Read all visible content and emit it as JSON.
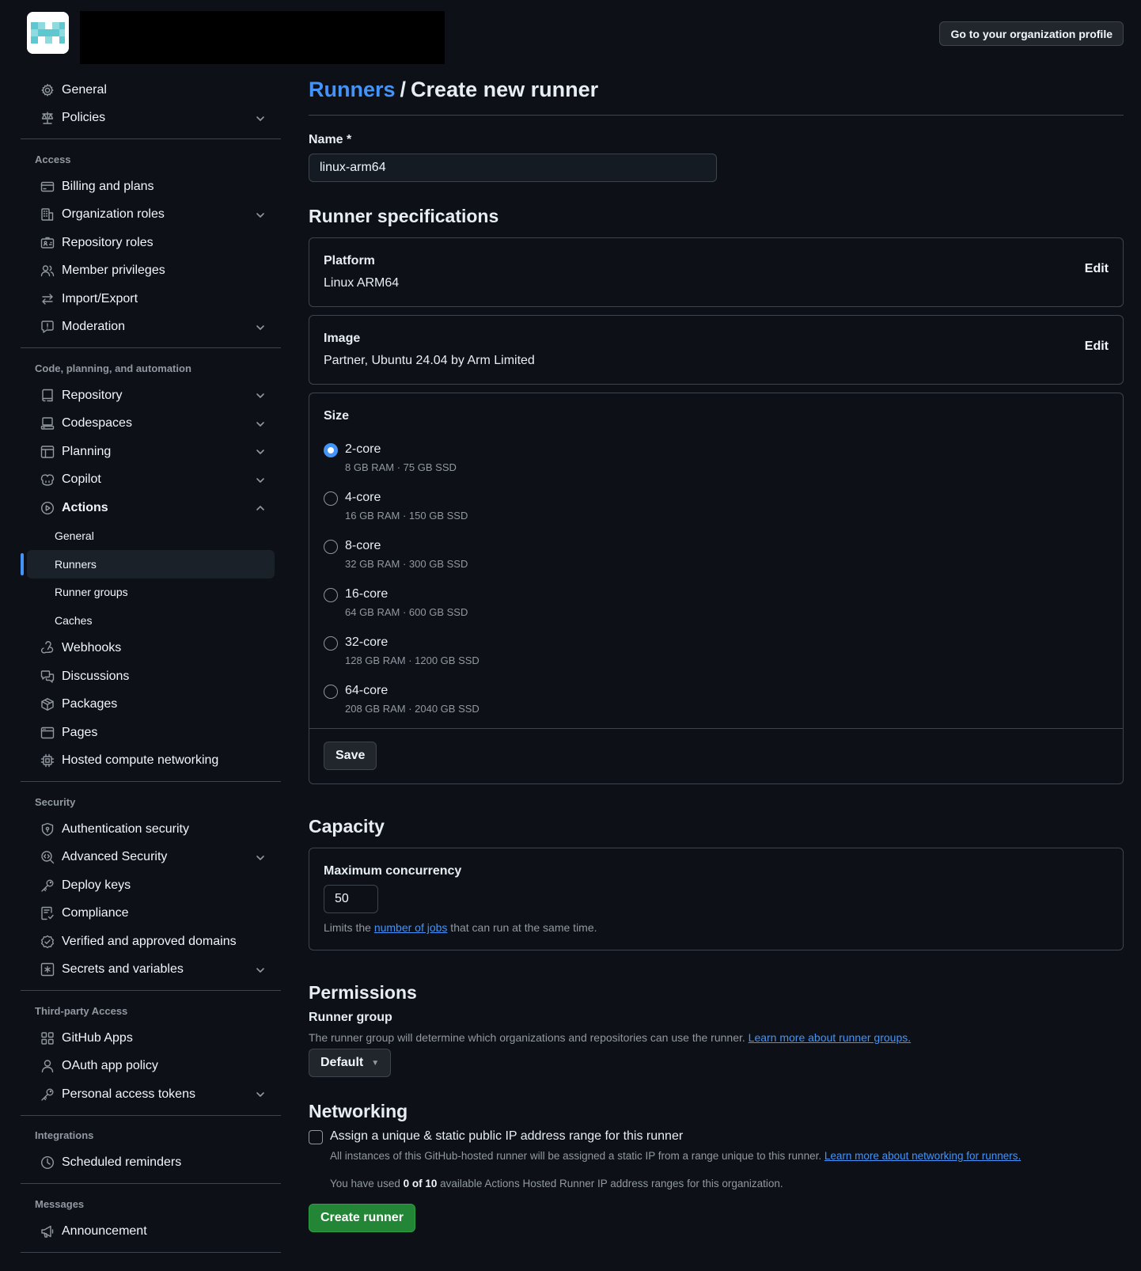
{
  "header": {
    "profile_button": "Go to your organization profile"
  },
  "sidebar": {
    "top": [
      {
        "label": "General",
        "icon": "gear-icon",
        "chevron": false
      },
      {
        "label": "Policies",
        "icon": "law-icon",
        "chevron": true
      }
    ],
    "sections": [
      {
        "heading": "Access",
        "items": [
          {
            "label": "Billing and plans",
            "icon": "credit-card-icon",
            "chevron": false
          },
          {
            "label": "Organization roles",
            "icon": "organization-icon",
            "chevron": true
          },
          {
            "label": "Repository roles",
            "icon": "id-badge-icon",
            "chevron": false
          },
          {
            "label": "Member privileges",
            "icon": "people-icon",
            "chevron": false
          },
          {
            "label": "Import/Export",
            "icon": "arrow-switch-icon",
            "chevron": false
          },
          {
            "label": "Moderation",
            "icon": "report-icon",
            "chevron": true
          }
        ]
      },
      {
        "heading": "Code, planning, and automation",
        "items": [
          {
            "label": "Repository",
            "icon": "repo-icon",
            "chevron": true
          },
          {
            "label": "Codespaces",
            "icon": "codespaces-icon",
            "chevron": true
          },
          {
            "label": "Planning",
            "icon": "table-icon",
            "chevron": true
          },
          {
            "label": "Copilot",
            "icon": "copilot-icon",
            "chevron": true
          },
          {
            "label": "Actions",
            "icon": "play-icon",
            "chevron": true,
            "expanded": true,
            "children": [
              {
                "label": "General"
              },
              {
                "label": "Runners",
                "selected": true
              },
              {
                "label": "Runner groups"
              },
              {
                "label": "Caches"
              }
            ]
          },
          {
            "label": "Webhooks",
            "icon": "webhook-icon",
            "chevron": false
          },
          {
            "label": "Discussions",
            "icon": "comment-discussion-icon",
            "chevron": false
          },
          {
            "label": "Packages",
            "icon": "package-icon",
            "chevron": false
          },
          {
            "label": "Pages",
            "icon": "browser-icon",
            "chevron": false
          },
          {
            "label": "Hosted compute networking",
            "icon": "cpu-icon",
            "chevron": false
          }
        ]
      },
      {
        "heading": "Security",
        "items": [
          {
            "label": "Authentication security",
            "icon": "shield-lock-icon",
            "chevron": false
          },
          {
            "label": "Advanced Security",
            "icon": "codescan-icon",
            "chevron": true
          },
          {
            "label": "Deploy keys",
            "icon": "key-icon",
            "chevron": false
          },
          {
            "label": "Compliance",
            "icon": "checklist-icon",
            "chevron": false
          },
          {
            "label": "Verified and approved domains",
            "icon": "verified-icon",
            "chevron": false
          },
          {
            "label": "Secrets and variables",
            "icon": "key-asterisk-icon",
            "chevron": true
          }
        ]
      },
      {
        "heading": "Third-party Access",
        "items": [
          {
            "label": "GitHub Apps",
            "icon": "apps-icon",
            "chevron": false
          },
          {
            "label": "OAuth app policy",
            "icon": "person-icon",
            "chevron": false
          },
          {
            "label": "Personal access tokens",
            "icon": "key-icon",
            "chevron": true
          }
        ]
      },
      {
        "heading": "Integrations",
        "items": [
          {
            "label": "Scheduled reminders",
            "icon": "clock-icon",
            "chevron": false
          }
        ]
      },
      {
        "heading": "Messages",
        "items": [
          {
            "label": "Announcement",
            "icon": "megaphone-icon",
            "chevron": false
          }
        ]
      }
    ]
  },
  "main": {
    "breadcrumb": "Runners",
    "separator": "/",
    "title": "Create new runner",
    "name_label": "Name *",
    "name_value": "linux-arm64",
    "specs_title": "Runner specifications",
    "platform": {
      "title": "Platform",
      "value": "Linux ARM64",
      "edit": "Edit"
    },
    "image": {
      "title": "Image",
      "value": "Partner, Ubuntu 24.04 by Arm Limited",
      "edit": "Edit"
    },
    "size": {
      "title": "Size",
      "options": [
        {
          "name": "2-core",
          "desc": "8 GB RAM · 75 GB SSD",
          "checked": true
        },
        {
          "name": "4-core",
          "desc": "16 GB RAM · 150 GB SSD",
          "checked": false
        },
        {
          "name": "8-core",
          "desc": "32 GB RAM · 300 GB SSD",
          "checked": false
        },
        {
          "name": "16-core",
          "desc": "64 GB RAM · 600 GB SSD",
          "checked": false
        },
        {
          "name": "32-core",
          "desc": "128 GB RAM · 1200 GB SSD",
          "checked": false
        },
        {
          "name": "64-core",
          "desc": "208 GB RAM · 2040 GB SSD",
          "checked": false
        }
      ],
      "save": "Save"
    },
    "capacity": {
      "title": "Capacity",
      "label": "Maximum concurrency",
      "value": "50",
      "hint_pre": "Limits the ",
      "hint_link": "number of jobs",
      "hint_post": " that can run at the same time."
    },
    "permissions": {
      "title": "Permissions",
      "label": "Runner group",
      "hint": "The runner group will determine which organizations and repositories can use the runner. ",
      "hint_link": "Learn more about runner groups.",
      "select_value": "Default"
    },
    "networking": {
      "title": "Networking",
      "checkbox_label": "Assign a unique & static public IP address range for this runner",
      "desc": "All instances of this GitHub-hosted runner will be assigned a static IP from a range unique to this runner. ",
      "desc_link": "Learn more about networking for runners.",
      "used_pre": "You have used ",
      "used_count": "0 of 10",
      "used_post": " available Actions Hosted Runner IP address ranges for this organization."
    },
    "create_button": "Create runner"
  },
  "colors": {
    "background": "#0d1117",
    "accent": "#4493f8",
    "primary_button": "#238636",
    "border": "#3d444d"
  }
}
